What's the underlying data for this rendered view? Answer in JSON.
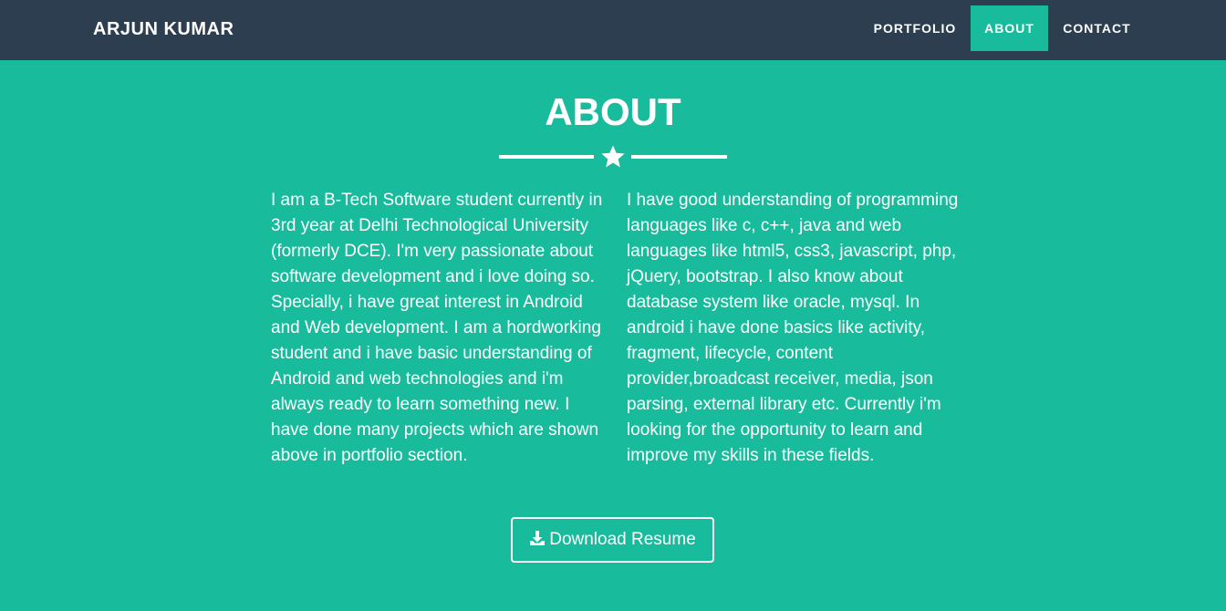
{
  "navbar": {
    "brand": "ARJUN KUMAR",
    "items": [
      {
        "label": "PORTFOLIO",
        "active": false
      },
      {
        "label": "ABOUT",
        "active": true
      },
      {
        "label": "CONTACT",
        "active": false
      }
    ]
  },
  "about": {
    "title": "ABOUT",
    "divider_icon": "star-icon",
    "left_text": "I am a B-Tech Software student currently in 3rd year at Delhi Technological University (formerly DCE). I'm very passionate about software development and i love doing so. Specially, i have great interest in Android and Web development. I am a hordworking student and i have basic understanding of Android and web technologies and i'm always ready to learn something new. I have done many projects which are shown above in portfolio section.",
    "right_text": "I have good understanding of programming languages like c, c++, java and web languages like html5, css3, javascript, php, jQuery, bootstrap. I also know about database system like oracle, mysql. In android i have done basics like activity, fragment, lifecycle, content provider,broadcast receiver, media, json parsing, external library etc. Currently i'm looking for the opportunity to learn and improve my skills in these fields.",
    "download_button": {
      "label": "Download Resume",
      "icon": "download-icon"
    }
  },
  "colors": {
    "navbar_bg": "#2c3e50",
    "accent": "#18bc9c",
    "text": "#ffffff"
  }
}
